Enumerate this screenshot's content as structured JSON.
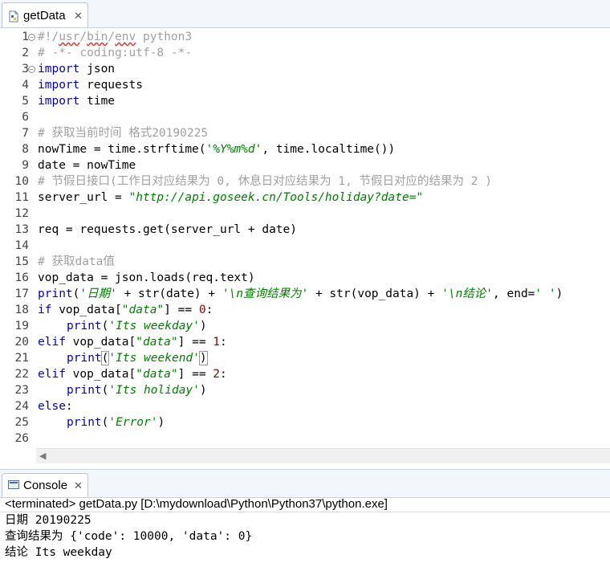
{
  "editor_tab": {
    "title": "getData",
    "close": "✕"
  },
  "code": {
    "l1": "#!/usr/bin/env python3",
    "l1_a": "#!/",
    "l1_b": "usr",
    "l1_c": "/",
    "l1_d": "bin",
    "l1_e": "/",
    "l1_f": "env",
    "l1_g": " python3",
    "l2": "# -*- coding:utf-8 -*-",
    "l3_kw": "import",
    "l3_rest": " json",
    "l4_kw": "import",
    "l4_rest": " requests",
    "l5_kw": "import",
    "l5_rest": " time",
    "l7": "# 获取当前时间 格式20190225",
    "l8_a": "nowTime = time.strftime(",
    "l8_str": "'%Y%m%d'",
    "l8_b": ", time.localtime())",
    "l9": "date = nowTime",
    "l10": "# 节假日接口(工作日对应结果为 0, 休息日对应结果为 1, 节假日对应的结果为 2 )",
    "l11_a": "server_url = ",
    "l11_str": "\"http://api.goseek.cn/Tools/holiday?date=\"",
    "l13": "req = requests.get(server_url + date)",
    "l15": "# 获取data值",
    "l16": "vop_data = json.loads(req.text)",
    "l17_kw": "print",
    "l17_a": "(",
    "l17_s1": "'日期'",
    "l17_b": " + str(date) + ",
    "l17_s2": "'\\n查询结果为'",
    "l17_c": " + str(vop_data) + ",
    "l17_s3": "'\\n结论'",
    "l17_d": ", end=",
    "l17_s4": "' '",
    "l17_e": ")",
    "l18_kw": "if",
    "l18_a": " vop_data[",
    "l18_s": "\"data\"",
    "l18_b": "] == ",
    "l18_n": "0",
    "l18_c": ":",
    "l19_kw": "print",
    "l19_a": "(",
    "l19_s": "'Its weekday'",
    "l19_b": ")",
    "l20_kw": "elif",
    "l20_a": " vop_data[",
    "l20_s": "\"data\"",
    "l20_b": "] == ",
    "l20_n": "1",
    "l20_c": ":",
    "l21_kw": "print",
    "l21_a": "(",
    "l21_s": "'Its weekend'",
    "l21_b": ")",
    "l22_kw": "elif",
    "l22_a": " vop_data[",
    "l22_s": "\"data\"",
    "l22_b": "] == ",
    "l22_n": "2",
    "l22_c": ":",
    "l23_kw": "print",
    "l23_a": "(",
    "l23_s": "'Its holiday'",
    "l23_b": ")",
    "l24_kw": "else",
    "l24_a": ":",
    "l25_kw": "print",
    "l25_a": "(",
    "l25_s": "'Error'",
    "l25_b": ")"
  },
  "line_numbers": [
    "1",
    "2",
    "3",
    "4",
    "5",
    "6",
    "7",
    "8",
    "9",
    "10",
    "11",
    "12",
    "13",
    "14",
    "15",
    "16",
    "17",
    "18",
    "19",
    "20",
    "21",
    "22",
    "23",
    "24",
    "25",
    "26"
  ],
  "console": {
    "tab_title": "Console",
    "close": "✕",
    "terminated": "<terminated> getData.py [D:\\mydownload\\Python\\Python37\\python.exe]",
    "out1": "日期 20190225",
    "out2": "查询结果为 {'code': 10000, 'data': 0}",
    "out3": "结论 Its weekday"
  },
  "colors": {
    "keyword": "#0000c8",
    "comment": "#a0a0a0",
    "string": "#008000",
    "number": "#8b0000"
  },
  "icons": {
    "file": "python-file-icon",
    "console": "console-icon"
  }
}
